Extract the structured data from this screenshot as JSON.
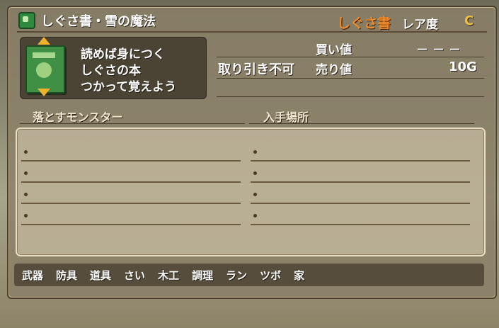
{
  "header": {
    "item_name": "しぐさ書・雪の魔法",
    "category": "しぐさ書",
    "rarity_label": "レア度",
    "rarity_value": "C"
  },
  "item": {
    "icon": "green-book-icon",
    "description": [
      "読めば身につく",
      "しぐさの本",
      "つかって覚えよう"
    ]
  },
  "prices": {
    "buy_label": "買い値",
    "buy_value": "－－－",
    "trade_status": "取り引き不可",
    "sell_label": "売り値",
    "sell_value": "10G"
  },
  "sections": {
    "drop_header": "落とすモンスター",
    "obtain_header": "入手場所"
  },
  "drop_monsters": [
    "",
    "",
    "",
    ""
  ],
  "obtain_places": [
    "",
    "",
    "",
    ""
  ],
  "tabs": [
    "武器",
    "防具",
    "道具",
    "さい",
    "木工",
    "調理",
    "ラン",
    "ツボ",
    "家"
  ],
  "colors": {
    "category": "#f08a2a",
    "rarity": "#f0c040",
    "arrows": "#f0b030",
    "book": "#3f8f44"
  }
}
